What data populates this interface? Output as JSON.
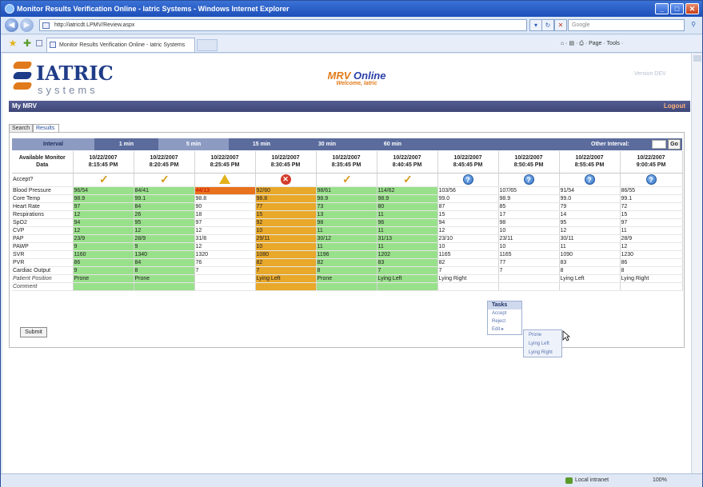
{
  "window": {
    "title": "Monitor Results Verification Online - Iatric Systems - Windows Internet Explorer"
  },
  "browser": {
    "url": "http://iatricdt.LPMV/Review.aspx",
    "search_placeholder": "Google",
    "tab_title": "Monitor Results Verification Online - Iatric Systems",
    "commands": "⌂ · ▤ · ⎙ · Page · Tools ·",
    "status_zone": "Local intranet",
    "zoom": "100%"
  },
  "header": {
    "brand_name": "IATRIC",
    "brand_sub": "systems",
    "app_title_a": "MRV",
    "app_title_b": "Online",
    "welcome": "Welcome, Iatric",
    "version": "Version DEV"
  },
  "nav": {
    "my_mrv": "My MRV",
    "logout": "Logout"
  },
  "tabs": {
    "search": "Search",
    "results": "Results"
  },
  "intervals": {
    "label": "Interval",
    "items": [
      "1 min",
      "5 min",
      "15 min",
      "30 min",
      "60 min"
    ],
    "selected": "5 min",
    "other_label": "Other Interval:",
    "go": "Go"
  },
  "grid": {
    "corner": "Available Monitor Data",
    "columns": [
      {
        "date": "10/22/2007",
        "time": "8:15:45 PM"
      },
      {
        "date": "10/22/2007",
        "time": "8:20:45 PM"
      },
      {
        "date": "10/22/2007",
        "time": "8:25:45 PM"
      },
      {
        "date": "10/22/2007",
        "time": "8:30:45 PM"
      },
      {
        "date": "10/22/2007",
        "time": "8:35:45 PM"
      },
      {
        "date": "10/22/2007",
        "time": "8:40:45 PM"
      },
      {
        "date": "10/22/2007",
        "time": "8:45:45 PM"
      },
      {
        "date": "10/22/2007",
        "time": "8:50:45 PM"
      },
      {
        "date": "10/22/2007",
        "time": "8:55:45 PM"
      },
      {
        "date": "10/22/2007",
        "time": "9:00:45 PM"
      }
    ],
    "accept_label": "Accept?",
    "accept_icons": [
      "check-icon",
      "check-icon",
      "warning-icon",
      "error-icon",
      "check-icon",
      "check-icon",
      "question-icon",
      "question-icon",
      "question-icon",
      "question-icon"
    ],
    "rows": [
      {
        "label": "Blood Pressure",
        "values": [
          "96/54",
          "84/41",
          "44/13",
          "92/60",
          "98/61",
          "114/62",
          "103/56",
          "107/65",
          "91/54",
          "86/55"
        ]
      },
      {
        "label": "Core Temp",
        "values": [
          "98.9",
          "99.1",
          "98.8",
          "98.8",
          "98.9",
          "98.9",
          "99.0",
          "98.9",
          "99.0",
          "99.1"
        ]
      },
      {
        "label": "Heart Rate",
        "values": [
          "97",
          "84",
          "90",
          "77",
          "73",
          "80",
          "87",
          "85",
          "79",
          "72"
        ]
      },
      {
        "label": "Respirations",
        "values": [
          "12",
          "26",
          "18",
          "15",
          "13",
          "11",
          "15",
          "17",
          "14",
          "15"
        ]
      },
      {
        "label": "SpO2",
        "values": [
          "94",
          "95",
          "97",
          "92",
          "98",
          "96",
          "94",
          "98",
          "95",
          "97"
        ]
      },
      {
        "label": "CVP",
        "values": [
          "12",
          "12",
          "12",
          "10",
          "11",
          "11",
          "12",
          "10",
          "12",
          "11"
        ]
      },
      {
        "label": "PAP",
        "values": [
          "23/9",
          "28/9",
          "31/8",
          "29/11",
          "30/12",
          "31/13",
          "23/10",
          "23/11",
          "30/11",
          "28/9"
        ]
      },
      {
        "label": "PAWP",
        "values": [
          "9",
          "9",
          "12",
          "10",
          "11",
          "11",
          "10",
          "10",
          "11",
          "12"
        ]
      },
      {
        "label": "SVR",
        "values": [
          "1160",
          "1340",
          "1320",
          "1080",
          "1196",
          "1202",
          "1165",
          "1165",
          "1090",
          "1230"
        ]
      },
      {
        "label": "PVR",
        "values": [
          "86",
          "84",
          "76",
          "82",
          "82",
          "83",
          "82",
          "77",
          "83",
          "86"
        ]
      },
      {
        "label": "Cardiac Output",
        "values": [
          "9",
          "8",
          "7",
          "7",
          "8",
          "7",
          "7",
          "7",
          "8",
          "8"
        ]
      },
      {
        "label": "Patient Position",
        "values": [
          "Prone",
          "Prone",
          "",
          "Lying Left",
          "Prone",
          "Lying Left",
          "Lying Right",
          "",
          "Lying Left",
          "Lying Right"
        ]
      },
      {
        "label": "Comment",
        "values": [
          "",
          "",
          "",
          "",
          "",
          "",
          "",
          "",
          "",
          ""
        ]
      }
    ]
  },
  "submit": "Submit",
  "context_menu": {
    "header": "Tasks",
    "items": [
      "Accept",
      "Reject",
      "Edit ▸"
    ],
    "submenu": [
      "Prone",
      "Lying Left",
      "Lying Right"
    ]
  },
  "colors": {
    "accepted": "#99e08b",
    "warning": "#e8a82a",
    "critical": "#e8721d",
    "nav": "#3f4778"
  }
}
